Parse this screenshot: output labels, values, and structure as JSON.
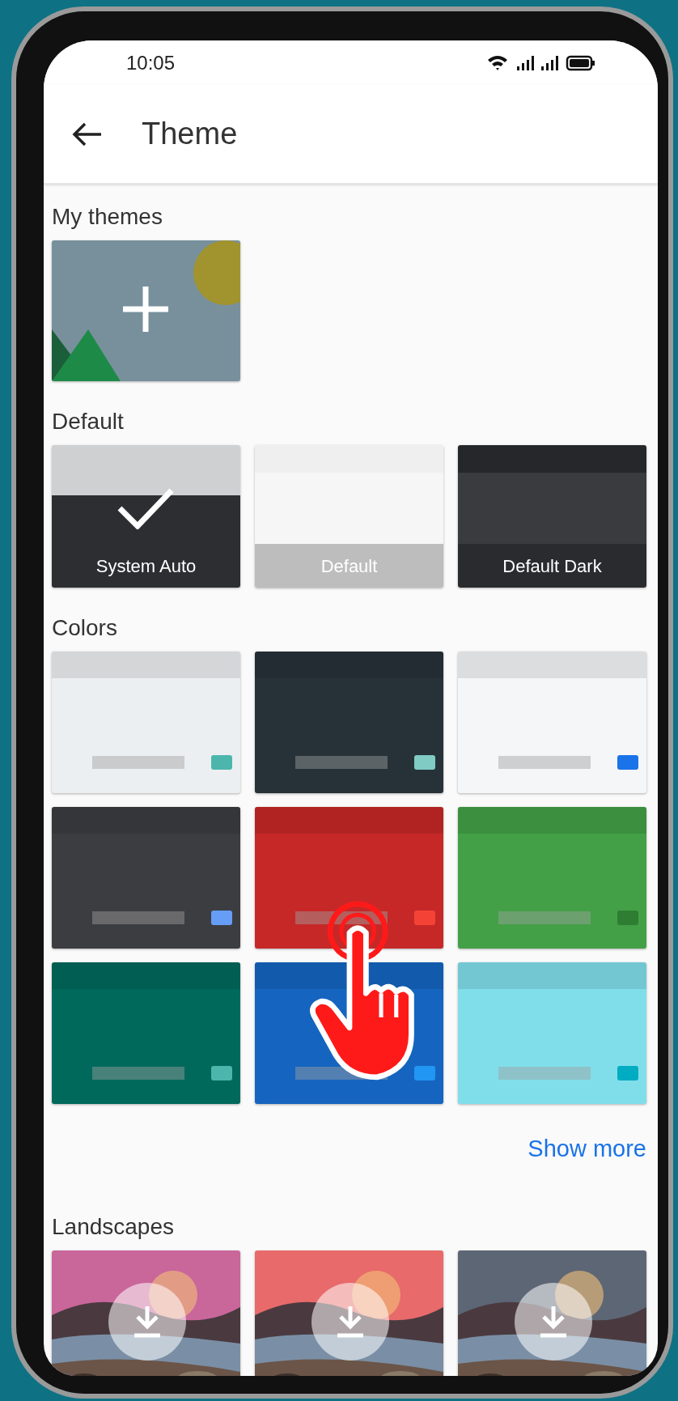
{
  "status_bar": {
    "time": "10:05"
  },
  "app_bar": {
    "title": "Theme"
  },
  "sections": [
    {
      "title": "My themes",
      "tiles": [
        {
          "kind": "add"
        }
      ]
    },
    {
      "title": "Default",
      "tiles": [
        {
          "kind": "system",
          "label": "System Auto",
          "selected": true
        },
        {
          "kind": "light",
          "label": "Default",
          "selected": false
        },
        {
          "kind": "dark",
          "label": "Default Dark",
          "selected": false
        }
      ]
    },
    {
      "title": "Colors",
      "tiles": [
        {
          "kind": "color",
          "color": "#eceff1",
          "swatch": {
            "color": "#4db6ac"
          }
        },
        {
          "kind": "color",
          "color": "#263238",
          "swatch": {
            "color": "#80cbc4"
          }
        },
        {
          "kind": "color",
          "color": "#f5f6f8",
          "swatch": {
            "color": "#1a73e8"
          }
        },
        {
          "kind": "color",
          "color": "#3c3d41",
          "swatch": {
            "color": "#669df6"
          }
        },
        {
          "kind": "color",
          "color": "#c62828",
          "swatch": {
            "color": "#f44336"
          }
        },
        {
          "kind": "color",
          "color": "#43a047",
          "swatch": {
            "color": "#2e7d32"
          }
        },
        {
          "kind": "color",
          "color": "#00695c",
          "swatch": {
            "color": "#4db6ac"
          }
        },
        {
          "kind": "color",
          "color": "#1565c0",
          "swatch": {
            "color": "#2196f3"
          }
        },
        {
          "kind": "color",
          "color": "#80deea",
          "swatch": {
            "color": "#00acc1"
          }
        }
      ],
      "link": "Show more"
    },
    {
      "title": "Landscapes"
    }
  ]
}
